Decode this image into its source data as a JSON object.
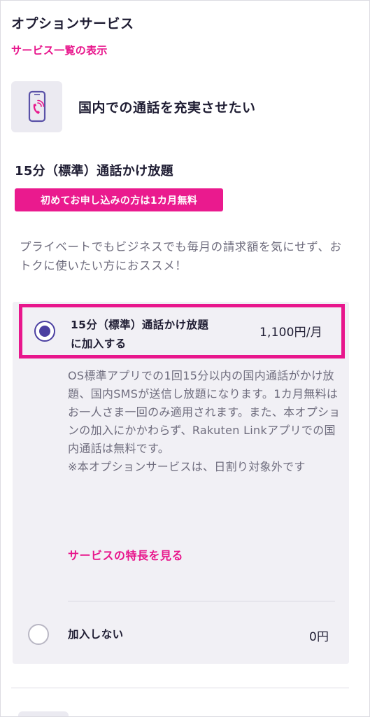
{
  "header": {
    "title": "オプションサービス",
    "list_link": "サービス一覧の表示"
  },
  "category": {
    "icon": "phone-call-icon",
    "label": "国内での通話を充実させたい"
  },
  "plan": {
    "title": "15分（標準）通話かけ放題",
    "badge": "初めてお申し込みの方は1カ月無料",
    "description": "プライベートでもビジネスでも毎月の請求額を気にせず、おトクに使いたい方におススメ！"
  },
  "options": {
    "subscribe": {
      "name_line1": "15分（標準）通話かけ放題",
      "name_line2": "に加入する",
      "price": "1,100円/月",
      "selected": true,
      "detail": "OS標準アプリでの1回15分以内の国内通話がかけ放題、国内SMSが送信し放題になります。1カ月無料はお一人さま一回のみ適用されます。また、本オプションの加入にかかわらず、Rakuten Linkアプリでの国内通話は無料です。",
      "note": "※本オプションサービスは、日割り対象外です",
      "feature_link": "サービスの特長を見る"
    },
    "decline": {
      "name": "加入しない",
      "price": "0円",
      "selected": false
    }
  },
  "colors": {
    "accent": "#e8168c",
    "radio": "#4b3fa1",
    "text": "#1f1d33",
    "muted": "#6e6c7d",
    "panel": "#f1f0f5"
  }
}
